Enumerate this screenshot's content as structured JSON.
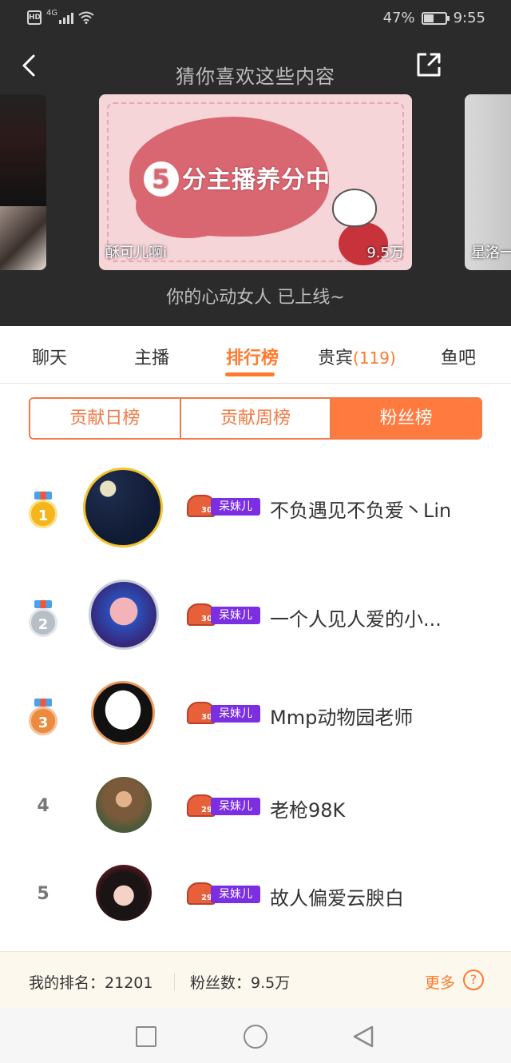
{
  "status_bar": {
    "network": "4G",
    "battery": "47%",
    "battery_level": 0.47,
    "time": "9:55"
  },
  "header": {
    "title": "猜你喜欢这些内容",
    "subtitle": "你的心动女人 已上线~"
  },
  "carousel": {
    "main_card": {
      "headline": "分主播养分中",
      "headline_number": "5",
      "caption": "酥可儿啊i",
      "count": "9.5万"
    },
    "right_card": {
      "caption": "星洛一"
    }
  },
  "tabs": [
    {
      "label": "聊天"
    },
    {
      "label": "主播"
    },
    {
      "label": "排行榜"
    },
    {
      "label": "贵宾",
      "count": "(119)"
    },
    {
      "label": "鱼吧"
    }
  ],
  "segments": [
    "贡献日榜",
    "贡献周榜",
    "粉丝榜"
  ],
  "rankings": [
    {
      "rank": "1",
      "badge_level": "30",
      "badge_name": "呆妹儿",
      "name": "不负遇见不负爱丶Lin"
    },
    {
      "rank": "2",
      "badge_level": "30",
      "badge_name": "呆妹儿",
      "name": "一个人见人爱的小..."
    },
    {
      "rank": "3",
      "badge_level": "30",
      "badge_name": "呆妹儿",
      "name": "Mmp动物园老师"
    },
    {
      "rank": "4",
      "badge_level": "29",
      "badge_name": "呆妹儿",
      "name": "老枪98K"
    },
    {
      "rank": "5",
      "badge_level": "29",
      "badge_name": "呆妹儿",
      "name": "故人偏爱云腴白"
    }
  ],
  "footer": {
    "my_rank_label": "我的排名：",
    "my_rank_value": "21201",
    "fans_label": "粉丝数：",
    "fans_value": "9.5万",
    "more": "更多",
    "help": "?"
  },
  "colors": {
    "accent": "#ff7a2e",
    "badge_purple": "#7b2fe0",
    "header_bg": "#2b2b2b"
  }
}
